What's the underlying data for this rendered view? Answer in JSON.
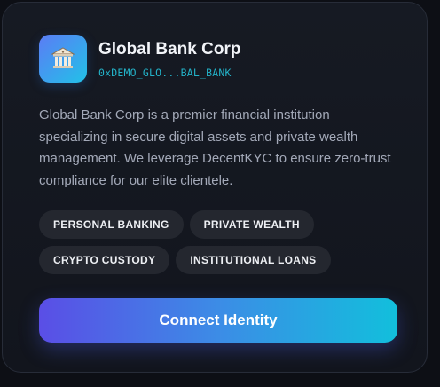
{
  "card": {
    "title": "Global Bank Corp",
    "address": "0xDEMO_GLO...BAL_BANK",
    "logo_icon": "bank-building-icon",
    "description": "Global Bank Corp is a premier financial institution specializing in secure digital assets and private wealth management. We leverage DecentKYC to ensure zero-trust compliance for our elite clientele.",
    "tags": [
      "PERSONAL BANKING",
      "PRIVATE WEALTH",
      "CRYPTO CUSTODY",
      "INSTITUTIONAL LOANS"
    ],
    "cta_label": "Connect Identity"
  },
  "colors": {
    "background": "#0d0f15",
    "card": "#161a23",
    "address": "#23b2c8",
    "tag_bg": "#24272f",
    "cta_start": "#5a4ee6",
    "cta_end": "#12bfdc"
  }
}
